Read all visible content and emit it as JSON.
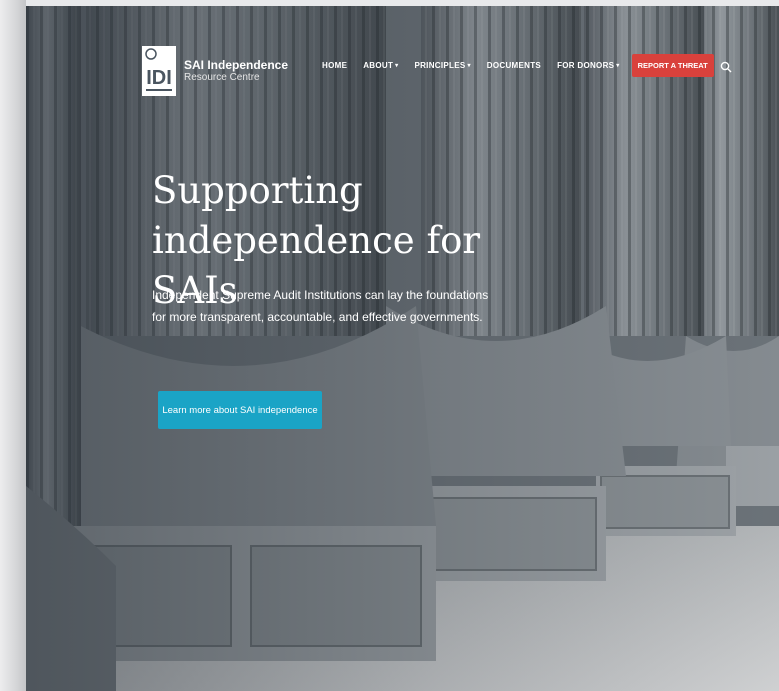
{
  "logo": {
    "mark_text": "IDI",
    "title": "SAI Independence",
    "subtitle": "Resource Centre"
  },
  "nav": {
    "items": [
      {
        "label": "HOME",
        "has_dropdown": false
      },
      {
        "label": "ABOUT",
        "has_dropdown": true
      },
      {
        "label": "PRINCIPLES",
        "has_dropdown": true
      },
      {
        "label": "DOCUMENTS",
        "has_dropdown": false
      },
      {
        "label": "FOR DONORS",
        "has_dropdown": true
      }
    ],
    "threat_label": "REPORT A THREAT",
    "search_icon": "search-icon",
    "chevron_glyph": "▾"
  },
  "hero": {
    "headline_line1": "Supporting",
    "headline_line2": "independence for SAIs",
    "lead": "Independent Supreme Audit Institutions can lay the foundations for more transparent, accountable, and effective governments.",
    "cta_label": "Learn more about SAI independence"
  },
  "colors": {
    "cta": "#1aa4c6",
    "threat": "#d9413c",
    "text": "#ffffff"
  }
}
